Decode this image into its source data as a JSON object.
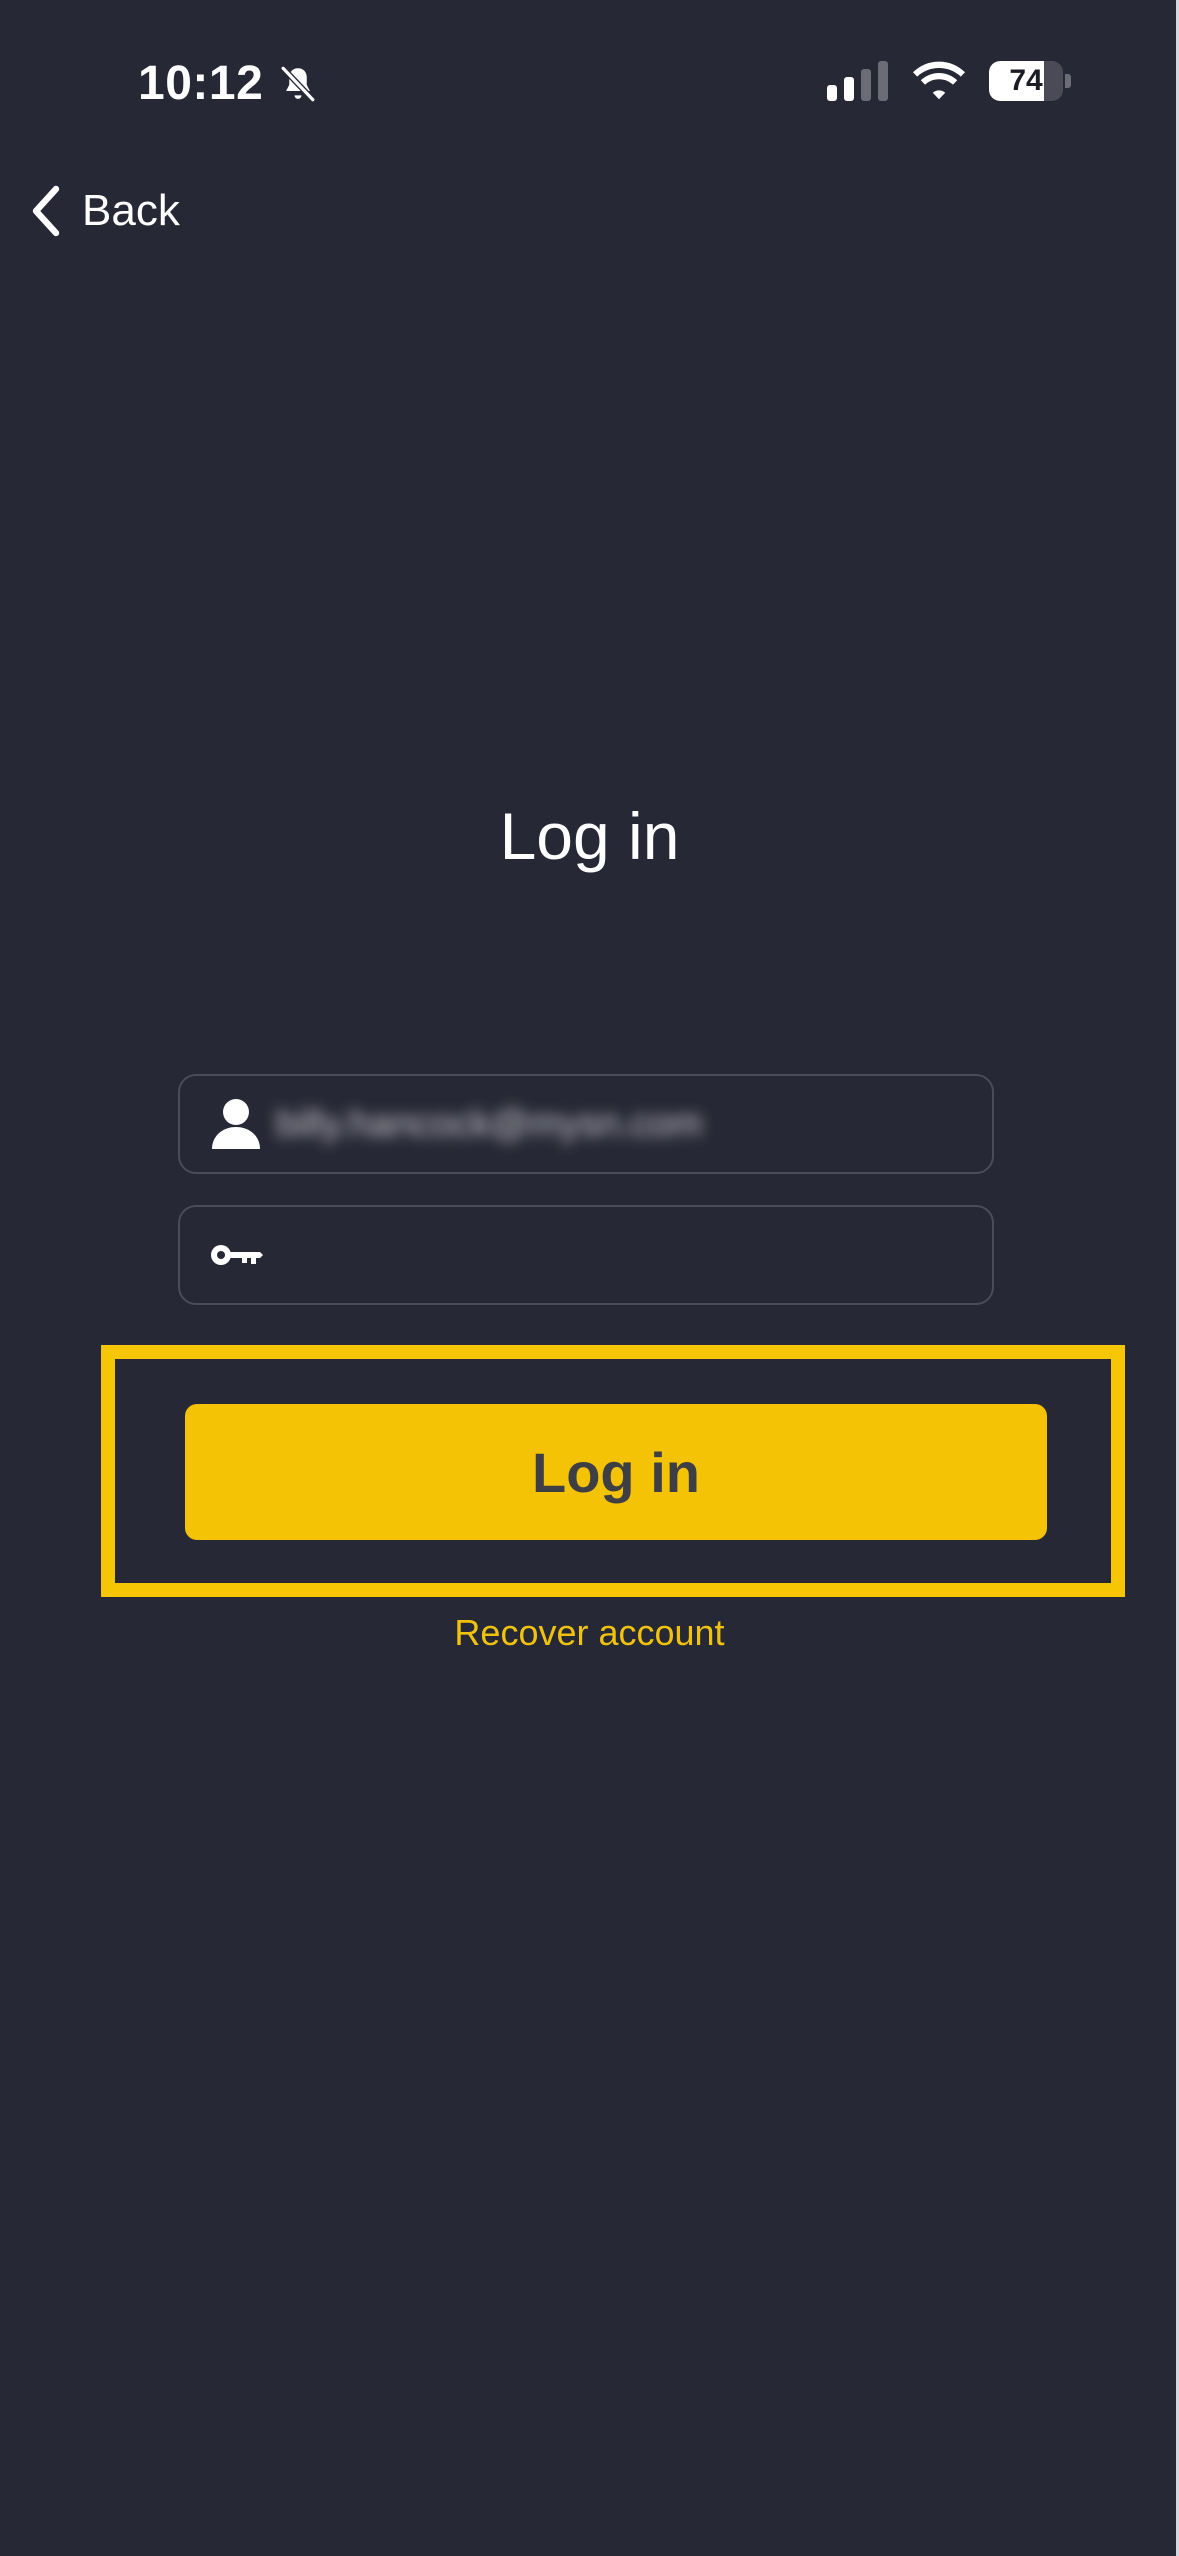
{
  "status_bar": {
    "time": "10:12",
    "battery_level": "74",
    "battery_fraction": 0.74,
    "icons": [
      "bell-off-icon",
      "signal-icon",
      "wifi-icon",
      "battery-icon"
    ]
  },
  "nav": {
    "back_label": "Back",
    "back_icon": "chevron-left-icon"
  },
  "page": {
    "title": "Log in"
  },
  "form": {
    "username": {
      "icon": "user-icon",
      "value": "billy.hancock@mysn.com"
    },
    "password": {
      "icon": "key-icon",
      "value": ""
    },
    "submit_label": "Log in",
    "recover_label": "Recover account"
  },
  "colors": {
    "background": "#272835",
    "accent": "#f4c305",
    "highlight": "#f6c504",
    "link": "#f0c20c",
    "field_border": "#4b4c59",
    "button_text": "#3e3f45"
  }
}
